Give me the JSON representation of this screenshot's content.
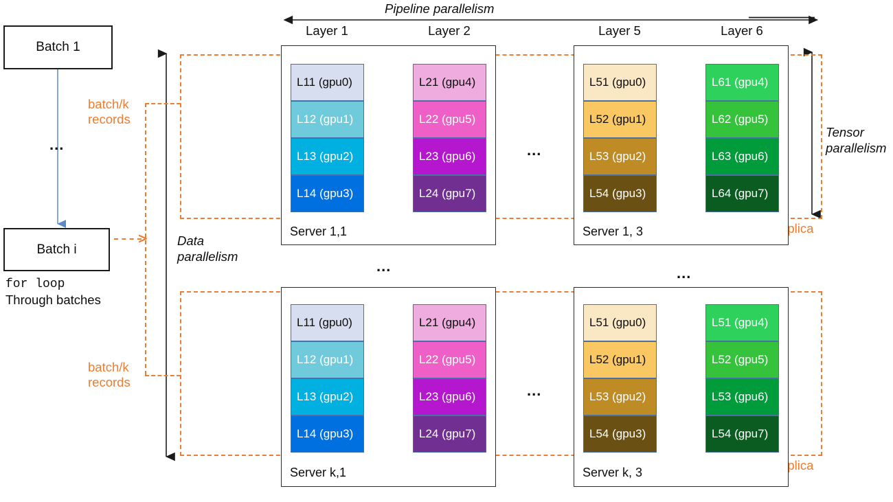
{
  "diagram": {
    "title_pipeline": "Pipeline parallelism",
    "label_tensor": "Tensor\nparallelism",
    "label_data": "Data\nparallelism",
    "ellipsis": "...",
    "accent_orange": "#ED7D31",
    "line_black": "#1a1a1a",
    "arrow_blue": "#5b8bc4"
  },
  "batches": {
    "first_label": "Batch 1",
    "last_label": "Batch i",
    "ellipsis": "...",
    "loop_line1": "for loop",
    "loop_line2": "Through batches"
  },
  "annotations": {
    "batch_k_top": "batch/k\nrecords",
    "batch_k_bottom": "batch/k\nrecords",
    "replica_top": "data parallel replica",
    "replica_bottom": "data parallel replica"
  },
  "layer_titles": {
    "layer1": "Layer 1",
    "layer2": "Layer 2",
    "layer5": "Layer 5",
    "layer6": "Layer 6"
  },
  "servers": [
    {
      "name": "server-1-1",
      "label": "Server 1,1",
      "columns": [
        {
          "name": "layer-1",
          "cells": [
            {
              "text": "L11 (gpu0)",
              "bg": "#D6DEEF",
              "fg": "#0d0d0d"
            },
            {
              "text": "L12 (gpu1)",
              "bg": "#6FCBDC",
              "fg": "#ffffff"
            },
            {
              "text": "L13 (gpu2)",
              "bg": "#00B0E0",
              "fg": "#ffffff"
            },
            {
              "text": "L14 (gpu3)",
              "bg": "#0070E0",
              "fg": "#ffffff"
            }
          ]
        },
        {
          "name": "layer-2",
          "cells": [
            {
              "text": "L21 (gpu4)",
              "bg": "#EFADDF",
              "fg": "#0d0d0d"
            },
            {
              "text": "L22 (gpu5)",
              "bg": "#EE5FC8",
              "fg": "#ffffff"
            },
            {
              "text": "L23 (gpu6)",
              "bg": "#B417CE",
              "fg": "#ffffff"
            },
            {
              "text": "L24 (gpu7)",
              "bg": "#713091",
              "fg": "#ffffff"
            }
          ]
        }
      ]
    },
    {
      "name": "server-1-3",
      "label": "Server 1, 3",
      "columns": [
        {
          "name": "layer-5",
          "cells": [
            {
              "text": "L51 (gpu0)",
              "bg": "#FAE7C4",
              "fg": "#0d0d0d"
            },
            {
              "text": "L52 (gpu1)",
              "bg": "#FAC863",
              "fg": "#0d0d0d"
            },
            {
              "text": "L53 (gpu2)",
              "bg": "#BE8B24",
              "fg": "#ffffff"
            },
            {
              "text": "L54 (gpu3)",
              "bg": "#6B5014",
              "fg": "#ffffff"
            }
          ]
        },
        {
          "name": "layer-6",
          "cells": [
            {
              "text": "L61 (gpu4)",
              "bg": "#2ED15C",
              "fg": "#ffffff"
            },
            {
              "text": "L62 (gpu5)",
              "bg": "#34C33B",
              "fg": "#ffffff"
            },
            {
              "text": "L63 (gpu6)",
              "bg": "#009B3A",
              "fg": "#ffffff"
            },
            {
              "text": "L64 (gpu7)",
              "bg": "#0B5C21",
              "fg": "#ffffff"
            }
          ]
        }
      ]
    },
    {
      "name": "server-k-1",
      "label": "Server k,1",
      "columns": [
        {
          "name": "layer-1",
          "cells": [
            {
              "text": "L11 (gpu0)",
              "bg": "#D6DEEF",
              "fg": "#0d0d0d"
            },
            {
              "text": "L12 (gpu1)",
              "bg": "#6FCBDC",
              "fg": "#ffffff"
            },
            {
              "text": "L13 (gpu2)",
              "bg": "#00B0E0",
              "fg": "#ffffff"
            },
            {
              "text": "L14 (gpu3)",
              "bg": "#0070E0",
              "fg": "#ffffff"
            }
          ]
        },
        {
          "name": "layer-2",
          "cells": [
            {
              "text": "L21 (gpu4)",
              "bg": "#EFADDF",
              "fg": "#0d0d0d"
            },
            {
              "text": "L22 (gpu5)",
              "bg": "#EE5FC8",
              "fg": "#ffffff"
            },
            {
              "text": "L23 (gpu6)",
              "bg": "#B417CE",
              "fg": "#ffffff"
            },
            {
              "text": "L24 (gpu7)",
              "bg": "#713091",
              "fg": "#ffffff"
            }
          ]
        }
      ]
    },
    {
      "name": "server-k-3",
      "label": "Server k, 3",
      "columns": [
        {
          "name": "layer-5",
          "cells": [
            {
              "text": "L51 (gpu0)",
              "bg": "#FAE7C4",
              "fg": "#0d0d0d"
            },
            {
              "text": "L52 (gpu1)",
              "bg": "#FAC863",
              "fg": "#0d0d0d"
            },
            {
              "text": "L53 (gpu2)",
              "bg": "#BE8B24",
              "fg": "#ffffff"
            },
            {
              "text": "L54 (gpu3)",
              "bg": "#6B5014",
              "fg": "#ffffff"
            }
          ]
        },
        {
          "name": "layer-6",
          "cells": [
            {
              "text": "L51 (gpu4)",
              "bg": "#2ED15C",
              "fg": "#ffffff"
            },
            {
              "text": "L52 (gpu5)",
              "bg": "#34C33B",
              "fg": "#ffffff"
            },
            {
              "text": "L53 (gpu6)",
              "bg": "#009B3A",
              "fg": "#ffffff"
            },
            {
              "text": "L54 (gpu7)",
              "bg": "#0B5C21",
              "fg": "#ffffff"
            }
          ]
        }
      ]
    }
  ]
}
